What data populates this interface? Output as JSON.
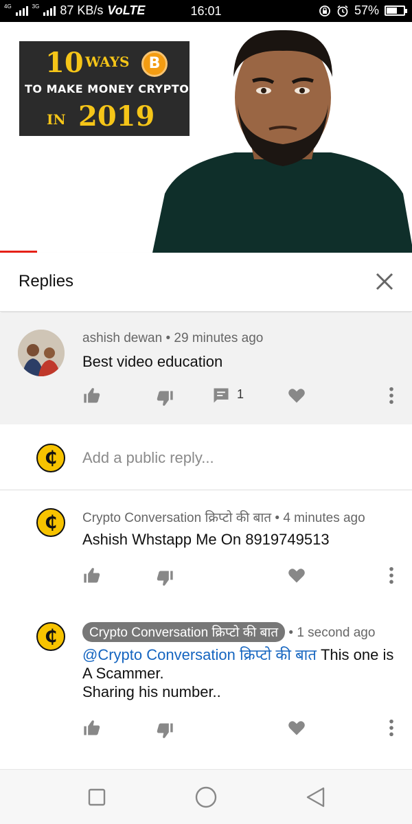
{
  "status_bar": {
    "network_left": "4G",
    "network_right": "3G",
    "speed": "87 KB/s",
    "volte": "VoLTE",
    "time": "16:01",
    "battery": "57%"
  },
  "video": {
    "thumbnail_line1_number": "10",
    "thumbnail_line1_word": "WAYS",
    "thumbnail_coin_symbol": "B",
    "thumbnail_line2": "TO MAKE MONEY CRYPTO",
    "thumbnail_line3_word": "IN",
    "thumbnail_line3_year": "2019",
    "progress_fraction": 0.09
  },
  "replies_panel": {
    "title": "Replies"
  },
  "parent_comment": {
    "author": "ashish dewan",
    "time": "29 minutes ago",
    "text": "Best video education",
    "reply_count": "1"
  },
  "reply_input": {
    "placeholder": "Add a public reply..."
  },
  "replies": [
    {
      "author": "Crypto Conversation क्रिप्टो की बात",
      "time": "4 minutes ago",
      "text": "Ashish Whstapp Me On 8919749513"
    },
    {
      "author": "Crypto Conversation क्रिप्टो की बात",
      "time": "1 second ago",
      "mention": "@Crypto Conversation क्रिप्टो की बात",
      "text_after_mention": " This one is A Scammer.",
      "text_line2": " Sharing his number.."
    }
  ],
  "coin_avatar_symbol": "₵",
  "colors": {
    "accent_red": "#e62117",
    "link_blue": "#1565c0",
    "coin_yellow": "#f7c300"
  }
}
